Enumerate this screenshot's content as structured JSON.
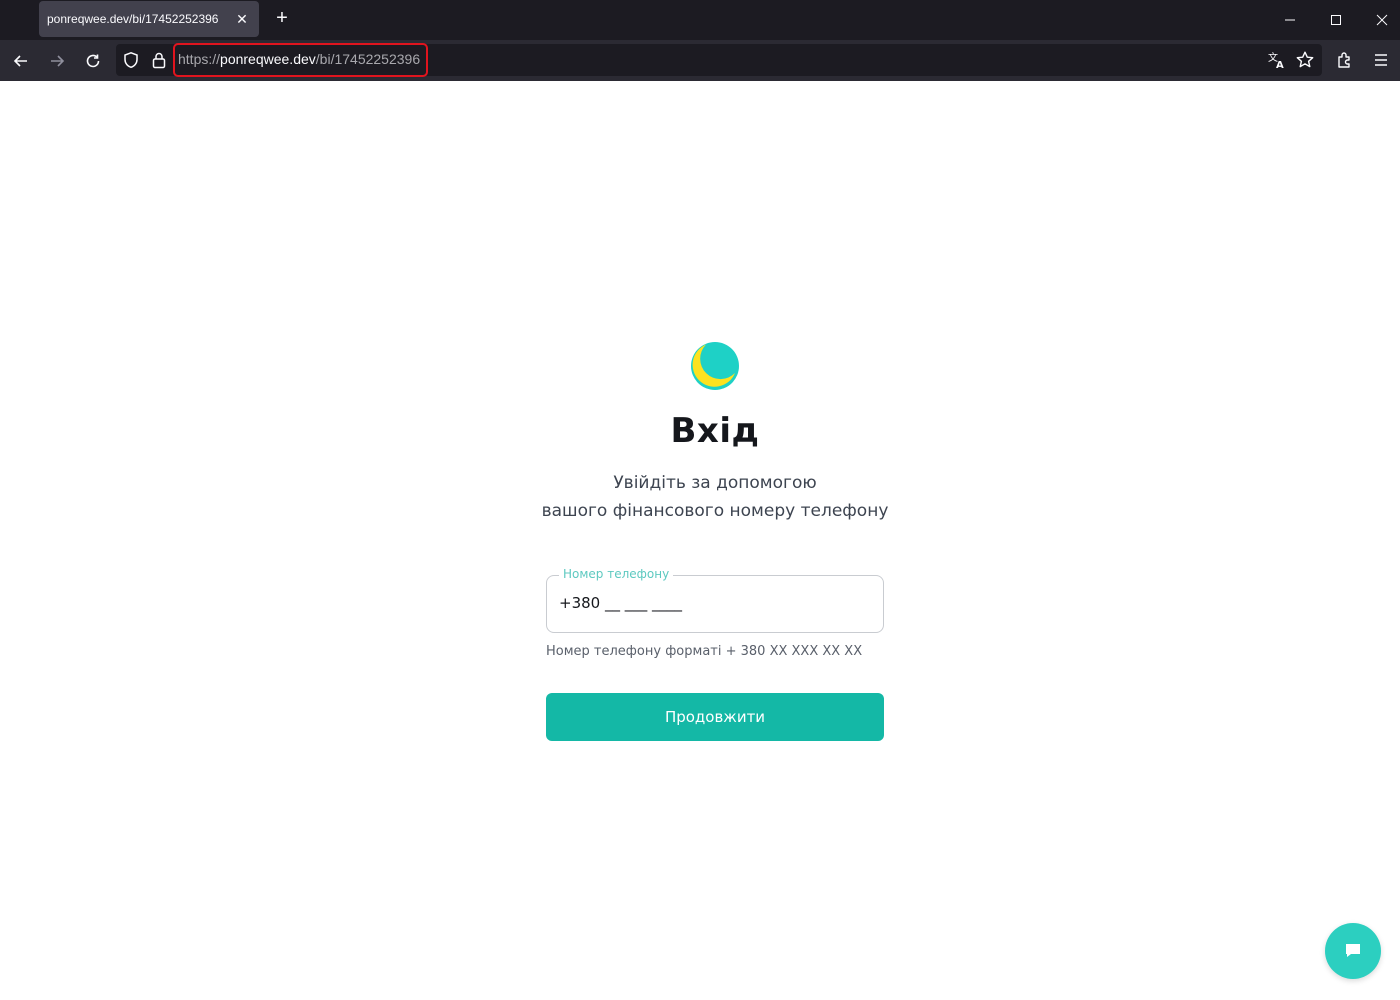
{
  "browser": {
    "tab_title": "ponreqwee.dev/bi/17452252396",
    "tab_close": "✕",
    "new_tab": "+",
    "url_scheme": "https://",
    "url_host": "ponreqwee.dev",
    "url_path": "/bi/17452252396"
  },
  "page": {
    "title": "Вхід",
    "subtitle_line1": "Увійдіть за допомогою",
    "subtitle_line2": "вашого фінансового номеру телефону",
    "phone_label": "Номер телефону",
    "phone_placeholder": "+380 __ ___ ____",
    "phone_helper": "Номер телефону форматі + 380 XX XXX XX XX",
    "submit_label": "Продовжити"
  },
  "colors": {
    "accent": "#14b8a6",
    "chat_button": "#2ccfc0",
    "logo_yellow": "#fde21f",
    "logo_teal": "#1ed1c6",
    "url_highlight": "#e0141e"
  }
}
